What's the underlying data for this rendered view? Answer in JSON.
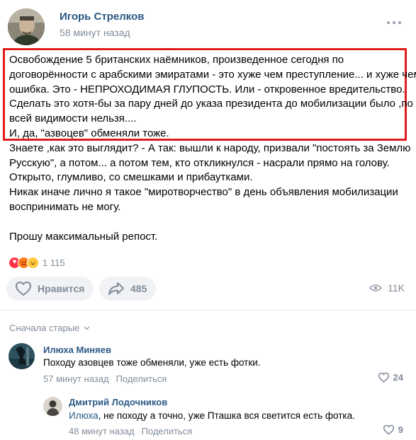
{
  "post": {
    "author": "Игорь Стрелков",
    "time": "58 минут назад",
    "lines": [
      "Освобождение 5 британских наёмников, произведенное сегодня по",
      "договорённости с арабскими эмиратами - это хуже чем преступление... и хуже чем",
      "ошибка. Это - НЕПРОХОДИМАЯ ГЛУПОСТЬ. Или - откровенное вредительство.",
      "Сделать это хотя-бы за пару дней до указа президента до мобилизации было ,по",
      "всей видимости нельзя....",
      "И, да, \"азвоцев\" обменяли тоже.",
      "Знаете ,как это выглядит? - А так: вышли к народу, призвали \"постоять за Землю",
      "Русскую\", а потом... а потом тем, кто откликнулся - насрали прямо на голову.",
      "Открыто, глумливо, со смешками и прибаутками.",
      "Никак иначе лично я такое \"миротворчество\" в день объявления мобилизации",
      "воспринимать не могу.",
      "Прошу максимальный репост."
    ],
    "reactions_count": "1 115",
    "like_label": "Нравится",
    "share_count": "485",
    "views": "11K",
    "highlight_color": "#e41b1b",
    "accent": "#2a5885"
  },
  "sort_label": "Сначала старые",
  "comments": [
    {
      "author": "Илюха Миняев",
      "text": "Походу азовцев тоже обменяли, уже есть фотки.",
      "time": "57 минут назад",
      "share_label": "Поделиться",
      "likes": "24"
    },
    {
      "author": "Дмитрий Лодочников",
      "mention": "Илюха",
      "text": ", не походу а точно, уже Пташка вся светится есть фотка.",
      "time": "48 минут назад",
      "share_label": "Поделиться",
      "likes": "9"
    }
  ]
}
